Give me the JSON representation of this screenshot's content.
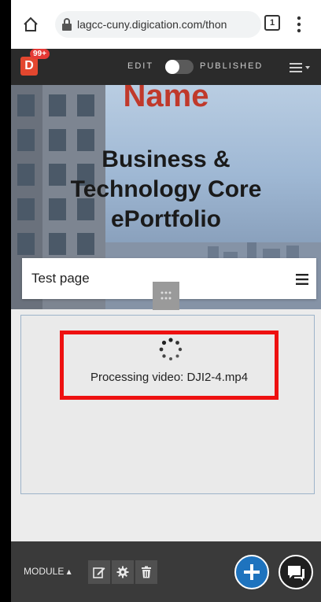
{
  "browser": {
    "url": "lagcc-cuny.digication.com/thon",
    "tab_count": "1"
  },
  "appbar": {
    "logo_letter": "D",
    "notifications": "99+",
    "edit_label": "EDIT",
    "published_label": "PUBLISHED",
    "toggle_on": false
  },
  "banner": {
    "name": "Name",
    "title_line1": "Business &",
    "title_line2": "Technology Core",
    "title_line3": "ePortfolio"
  },
  "page_card": {
    "title": "Test page"
  },
  "module": {
    "processing_text": "Processing video: DJI2-4.mp4"
  },
  "toolbar": {
    "module_label": "MODULE ▴"
  },
  "colors": {
    "accent_blue": "#1e73be",
    "highlight_red": "#ee1111",
    "logo_red": "#e3472f",
    "appbar_dark": "#2b2b2b"
  }
}
